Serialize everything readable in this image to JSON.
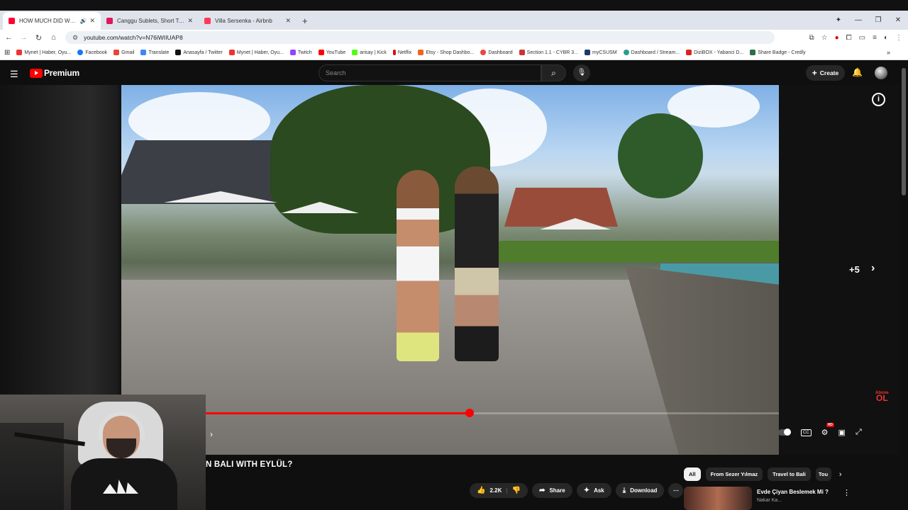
{
  "browser": {
    "tabs": [
      {
        "title": "HOW MUCH DID WE SPEN",
        "color": "#ff0033",
        "active": true
      },
      {
        "title": "Canggu Sublets, Short Term Re",
        "color": "#e0185b",
        "active": false
      },
      {
        "title": "Villa Sersenka - Airbnb",
        "color": "#ff385c",
        "active": false
      }
    ],
    "new_tab": "+",
    "url": "youtube.com/watch?v=N76iWIIUAP8",
    "bookmarks": [
      {
        "label": "Mynet | Haber, Oyu...",
        "color": "#e33"
      },
      {
        "label": "Facebook",
        "color": "#1877f2"
      },
      {
        "label": "Gmail",
        "color": "#ea4335"
      },
      {
        "label": "Translate",
        "color": "#4285f4"
      },
      {
        "label": "Anasayfa / Twitter",
        "color": "#111"
      },
      {
        "label": "Mynet | Haber, Oyu...",
        "color": "#e33"
      },
      {
        "label": "Twitch",
        "color": "#9146ff"
      },
      {
        "label": "YouTube",
        "color": "#f00"
      },
      {
        "label": "arisay | Kick",
        "color": "#53fc18"
      },
      {
        "label": "Netflix",
        "color": "#e50914"
      },
      {
        "label": "Etsy - Shop Dashbo...",
        "color": "#f1641e"
      },
      {
        "label": "Dashboard",
        "color": "#e44"
      },
      {
        "label": "Section 1.1 - CYBR 3...",
        "color": "#c33"
      },
      {
        "label": "myCSUSM",
        "color": "#1a3a6b"
      },
      {
        "label": "Dashboard / Stream...",
        "color": "#2a9d8f"
      },
      {
        "label": "DiziBOX - Yabanci D...",
        "color": "#d22"
      },
      {
        "label": "Share Badge - Credly",
        "color": "#2c6e49"
      }
    ]
  },
  "youtube": {
    "logo_text": "Premium",
    "search_placeholder": "Search",
    "create_label": "Create",
    "video": {
      "info_label": "i",
      "more_count": "+5",
      "channel_watermark_top": "Abone",
      "channel_watermark_bottom": "OL",
      "progress_fraction": 0.46
    },
    "title": "N BALI WITH EYLÜL?",
    "actions": {
      "likes": "2.2K",
      "share": "Share",
      "ask": "Ask",
      "download": "Download"
    },
    "chips": [
      "All",
      "From Sezer Yılmaz",
      "Travel to Bali",
      "Tou"
    ],
    "recommendation": {
      "title": "Evde Çiyan Beslemek Mi ?",
      "channel": "Nakar Ka..."
    }
  }
}
